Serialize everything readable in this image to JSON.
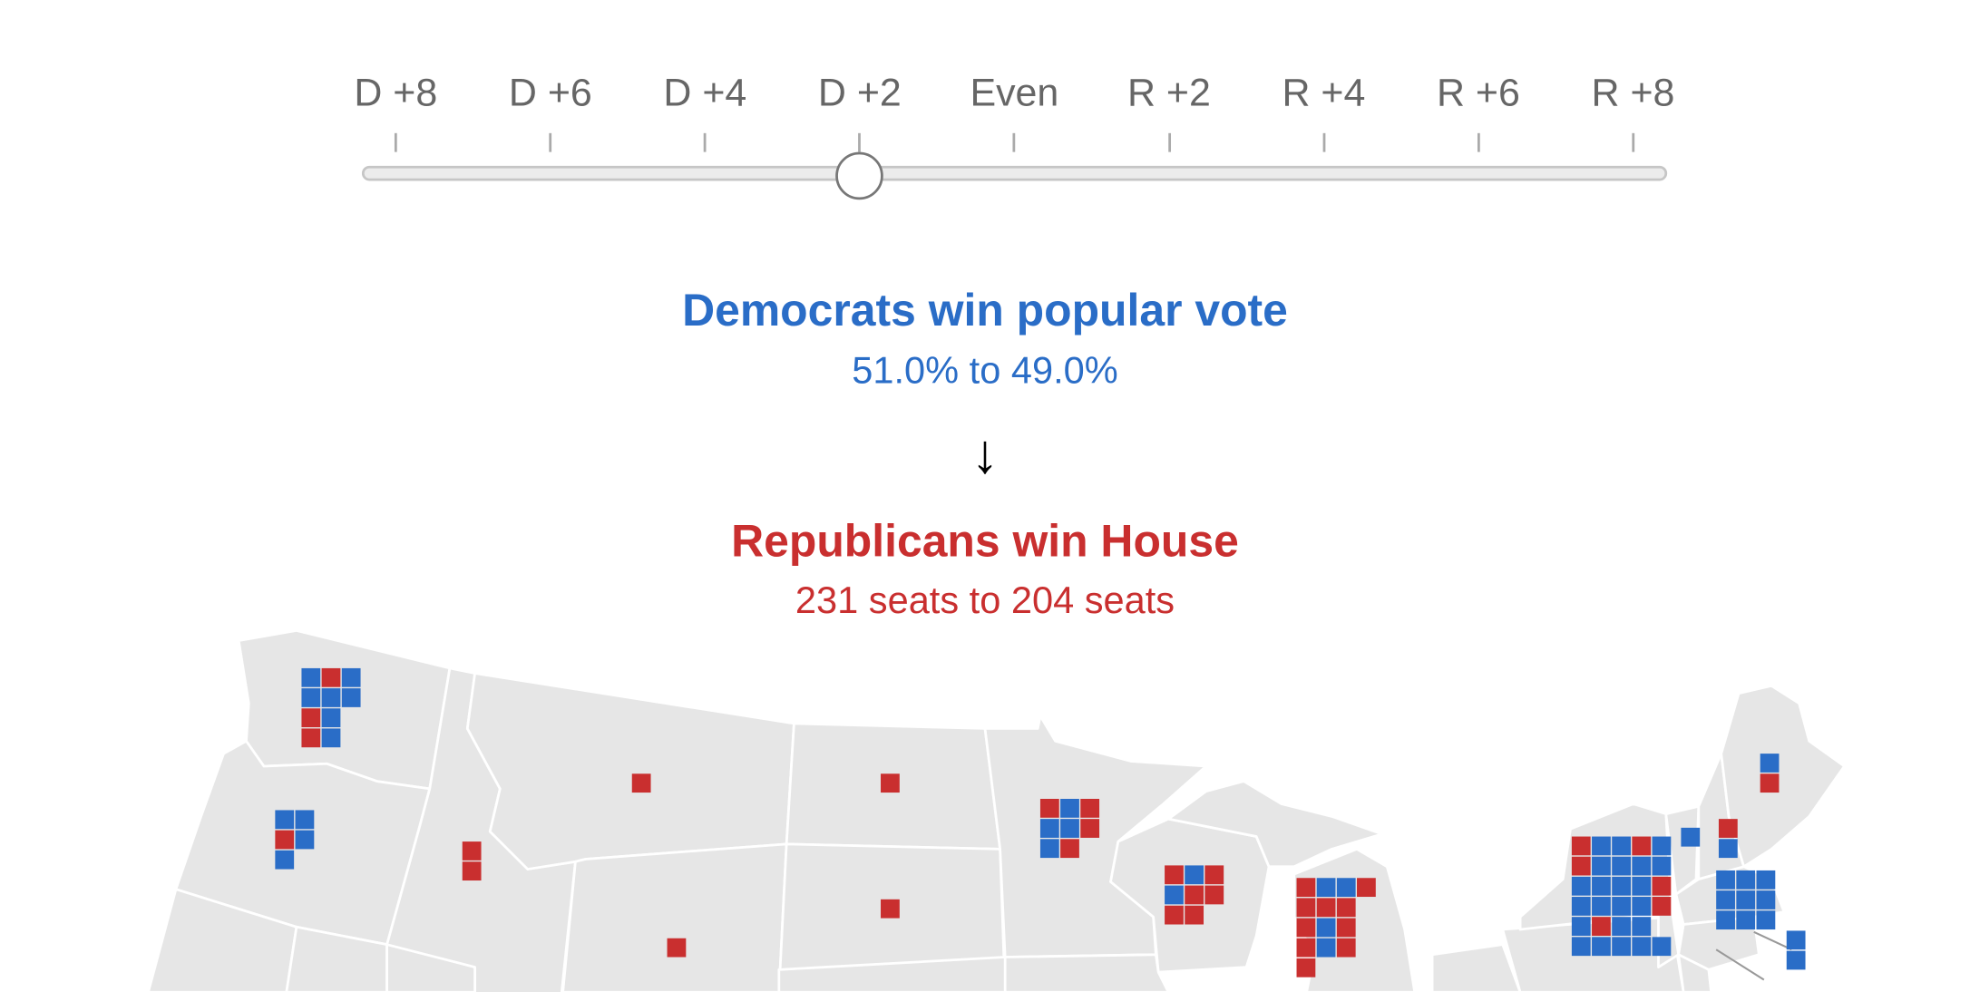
{
  "slider": {
    "ticks": [
      "D +8",
      "D +6",
      "D +4",
      "D +2",
      "Even",
      "R +2",
      "R +4",
      "R +6",
      "R +8"
    ],
    "selected": "D +2",
    "selected_index": 3
  },
  "popular_vote": {
    "headline": "Democrats win popular vote",
    "detail": "51.0% to 49.0%"
  },
  "arrow": "↓",
  "house": {
    "headline": "Republicans win House",
    "detail": "231 seats to 204 seats"
  },
  "colors": {
    "democrat": "#2a6dc7",
    "republican": "#c92f2f",
    "land": "#e6e6e6",
    "borders": "#ffffff"
  },
  "map": {
    "states": [
      {
        "name": "WA",
        "seats": [
          "D",
          "R",
          "D",
          "D",
          "D",
          "D",
          "R",
          "D",
          "R",
          "D"
        ]
      },
      {
        "name": "OR",
        "seats": [
          "D",
          "D",
          "R",
          "D",
          "D"
        ]
      },
      {
        "name": "ID",
        "seats": [
          "R",
          "R"
        ]
      },
      {
        "name": "MT",
        "seats": [
          "R"
        ]
      },
      {
        "name": "WY",
        "seats": [
          "R"
        ]
      },
      {
        "name": "ND",
        "seats": [
          "R"
        ]
      },
      {
        "name": "SD",
        "seats": [
          "R"
        ]
      },
      {
        "name": "MN",
        "seats": [
          "R",
          "D",
          "R",
          "D",
          "D",
          "R",
          "D",
          "R"
        ]
      },
      {
        "name": "WI",
        "seats": [
          "R",
          "D",
          "R",
          "D",
          "R",
          "R",
          "R",
          "R"
        ]
      },
      {
        "name": "MI",
        "seats": [
          "R",
          "D",
          "D",
          "R",
          "R",
          "R",
          "R",
          "R",
          "D",
          "R",
          "R",
          "D",
          "R",
          "R"
        ]
      },
      {
        "name": "NY",
        "seats": [
          "R",
          "D",
          "D",
          "R",
          "D",
          "R",
          "D",
          "D",
          "D",
          "D",
          "D",
          "D",
          "D",
          "D",
          "R",
          "D",
          "D",
          "D",
          "D",
          "R",
          "D",
          "R",
          "D",
          "D",
          "D",
          "D",
          "D",
          "D",
          "D"
        ]
      },
      {
        "name": "VT",
        "seats": [
          "D"
        ]
      },
      {
        "name": "NH",
        "seats": [
          "R",
          "D"
        ]
      },
      {
        "name": "ME",
        "seats": [
          "D",
          "R"
        ]
      },
      {
        "name": "MA",
        "seats": [
          "D",
          "D",
          "D",
          "D",
          "D",
          "D",
          "D",
          "D",
          "D"
        ]
      },
      {
        "name": "RI",
        "seats": [
          "D",
          "D"
        ]
      }
    ]
  }
}
